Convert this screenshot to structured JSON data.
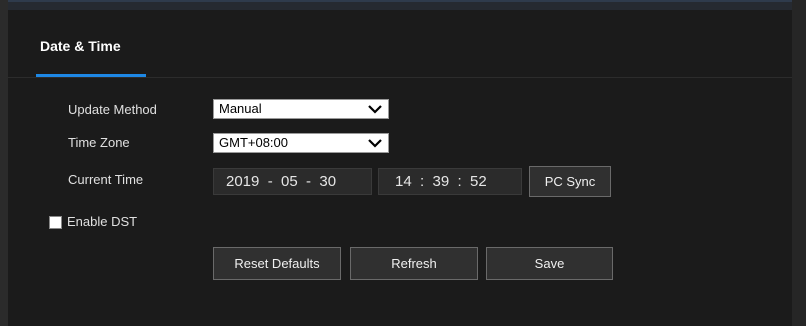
{
  "header": {
    "title": "Date & Time"
  },
  "form": {
    "update_method_label": "Update Method",
    "update_method_value": "Manual",
    "time_zone_label": "Time Zone",
    "time_zone_value": "GMT+08:00",
    "current_time_label": "Current Time",
    "date_value": "2019  -  05  -  30",
    "time_value": "14  :  39  :  52",
    "pc_sync_label": "PC Sync",
    "enable_dst_label": "Enable DST",
    "enable_dst_checked": false
  },
  "buttons": {
    "reset_defaults": "Reset Defaults",
    "refresh": "Refresh",
    "save": "Save"
  },
  "icons": {
    "dropdown": "chevron-down-icon",
    "checkbox": "checkbox-icon"
  },
  "colors": {
    "accent": "#1e88e5",
    "background": "#1b1b1b",
    "button_bg": "#303030"
  }
}
